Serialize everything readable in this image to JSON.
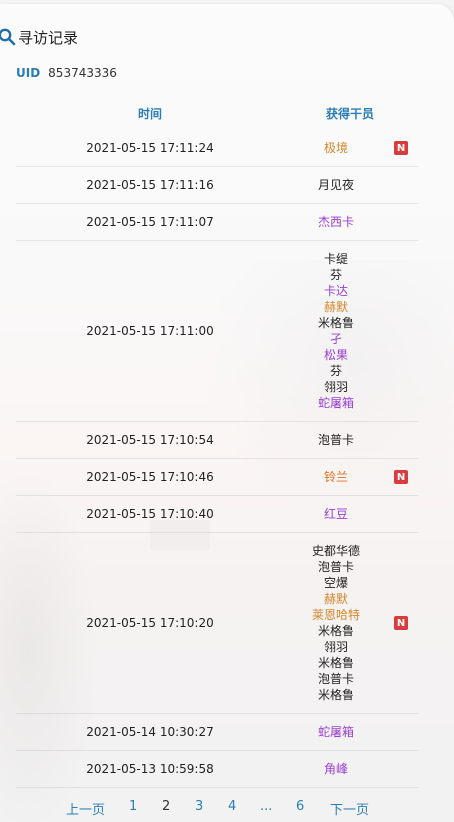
{
  "header": {
    "title": "寻访记录",
    "icon": "search-icon"
  },
  "uid": {
    "label": "UID",
    "value": "853743336"
  },
  "table": {
    "columns": [
      "时间",
      "获得干员"
    ],
    "rows": [
      {
        "time": "2021-05-15 17:11:24",
        "ops": [
          {
            "name": "极境",
            "color": "#d4872a"
          }
        ],
        "new": true
      },
      {
        "time": "2021-05-15 17:11:16",
        "ops": [
          {
            "name": "月见夜",
            "color": "#222222"
          }
        ],
        "new": false
      },
      {
        "time": "2021-05-15 17:11:07",
        "ops": [
          {
            "name": "杰西卡",
            "color": "#9a3fd1"
          }
        ],
        "new": false
      },
      {
        "time": "2021-05-15 17:11:00",
        "ops": [
          {
            "name": "卡缇",
            "color": "#222222"
          },
          {
            "name": "芬",
            "color": "#222222"
          },
          {
            "name": "卡达",
            "color": "#9a3fd1"
          },
          {
            "name": "赫默",
            "color": "#d4872a"
          },
          {
            "name": "米格鲁",
            "color": "#222222"
          },
          {
            "name": "孑",
            "color": "#9a3fd1"
          },
          {
            "name": "松果",
            "color": "#9a3fd1"
          },
          {
            "name": "芬",
            "color": "#222222"
          },
          {
            "name": "翎羽",
            "color": "#222222"
          },
          {
            "name": "蛇屠箱",
            "color": "#9a3fd1"
          }
        ],
        "new": false
      },
      {
        "time": "2021-05-15 17:10:54",
        "ops": [
          {
            "name": "泡普卡",
            "color": "#222222"
          }
        ],
        "new": false
      },
      {
        "time": "2021-05-15 17:10:46",
        "ops": [
          {
            "name": "铃兰",
            "color": "#e0701d"
          }
        ],
        "new": true
      },
      {
        "time": "2021-05-15 17:10:40",
        "ops": [
          {
            "name": "红豆",
            "color": "#9a3fd1"
          }
        ],
        "new": false
      },
      {
        "time": "2021-05-15 17:10:20",
        "ops": [
          {
            "name": "史都华德",
            "color": "#222222"
          },
          {
            "name": "泡普卡",
            "color": "#222222"
          },
          {
            "name": "空爆",
            "color": "#222222"
          },
          {
            "name": "赫默",
            "color": "#d4872a"
          },
          {
            "name": "莱恩哈特",
            "color": "#d4872a"
          },
          {
            "name": "米格鲁",
            "color": "#222222"
          },
          {
            "name": "翎羽",
            "color": "#222222"
          },
          {
            "name": "米格鲁",
            "color": "#222222"
          },
          {
            "name": "泡普卡",
            "color": "#222222"
          },
          {
            "name": "米格鲁",
            "color": "#222222"
          }
        ],
        "new": true
      },
      {
        "time": "2021-05-14 10:30:27",
        "ops": [
          {
            "name": "蛇屠箱",
            "color": "#9a3fd1"
          }
        ],
        "new": false
      },
      {
        "time": "2021-05-13 10:59:58",
        "ops": [
          {
            "name": "角峰",
            "color": "#9a3fd1"
          }
        ],
        "new": false
      }
    ],
    "new_badge": "N"
  },
  "pager": {
    "prev": "上一页",
    "pages": [
      "1",
      "2",
      "3",
      "4",
      "...",
      "6"
    ],
    "current": "2",
    "next": "下一页"
  }
}
